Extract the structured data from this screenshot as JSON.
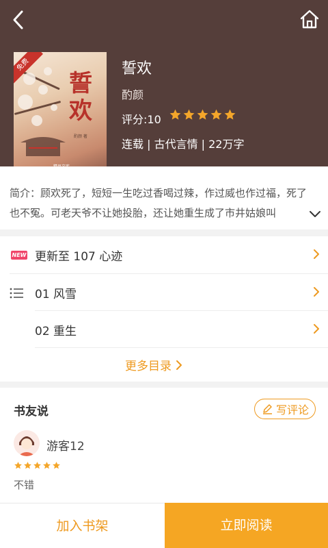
{
  "book": {
    "title": "誓欢",
    "author": "酌颜",
    "rating_label": "评分:10",
    "rating": 5,
    "meta": "连载 | 古代言情 | 22万字",
    "cover": {
      "title_art": "誓欢",
      "corner_tag": "免费",
      "author_art": "酌颜 著",
      "publisher_art": "精品文库"
    }
  },
  "intro": {
    "text": "简介：顾欢死了，短短一生吃过香喝过辣，作过威也作过福，死了也不冤。可老天爷不让她投胎，还让她重生成了市井姑娘叫"
  },
  "toc": {
    "new_badge": "NEW",
    "latest": "更新至 107 心迹",
    "items": [
      "01 风雪",
      "02 重生"
    ],
    "more": "更多目录"
  },
  "reviews": {
    "title": "书友说",
    "write_button": "写评论",
    "items": [
      {
        "user": "游客12",
        "stars": 5,
        "text": "不错"
      }
    ]
  },
  "actions": {
    "add_shelf": "加入书架",
    "read_now": "立即阅读"
  },
  "colors": {
    "header_bg": "#553e3a",
    "accent": "#ee9a20",
    "primary_button": "#f5a623",
    "star": "#f4a62a",
    "new_badge": "#f0456a"
  },
  "icons": {
    "back": "back-arrow-icon",
    "home": "home-icon",
    "expand": "chevron-down-icon",
    "list": "list-icon",
    "chevron": "chevron-right-icon",
    "edit": "pencil-icon"
  }
}
